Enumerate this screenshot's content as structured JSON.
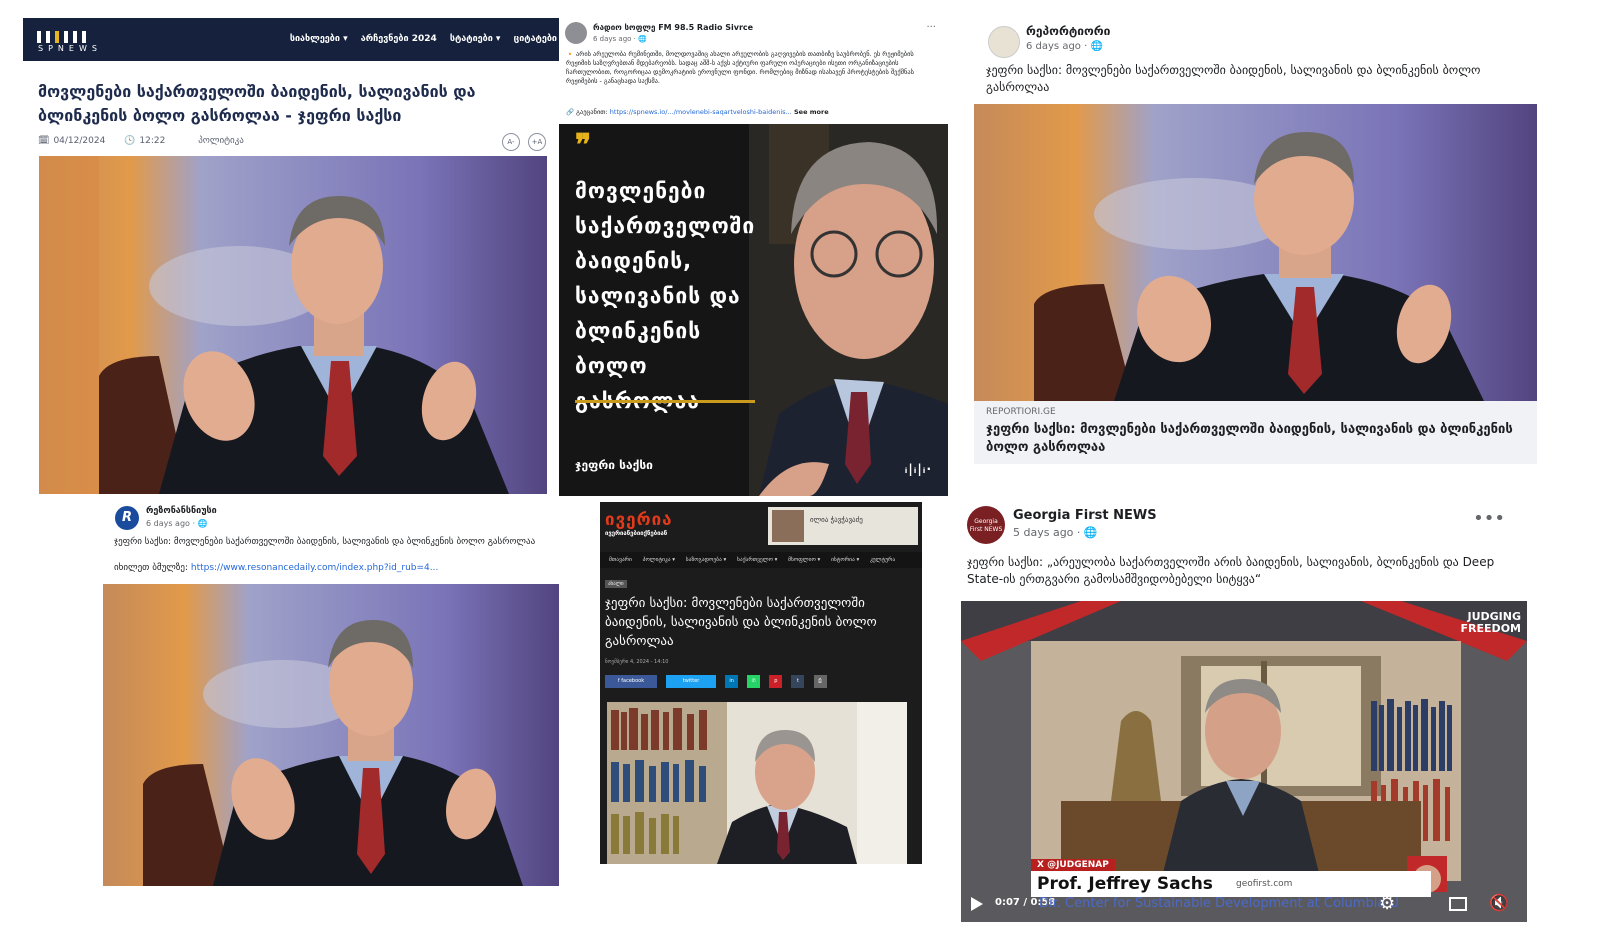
{
  "spnews": {
    "logo": "SPNEWS",
    "menu": [
      "სიახლეები ▾",
      "არჩევნები 2024",
      "სტატიები ▾",
      "ციტატები"
    ],
    "headline": "მოვლენები საქართველოში ბაიდენის, სალივანის და ბლინკენის ბოლო გასროლაა - ჯეფრი საქსი",
    "date": "04/12/2024",
    "time": "12:22",
    "category": "პოლიტიკა",
    "font_minus": "A-",
    "font_plus": "+A"
  },
  "radio_post": {
    "page_name": "რადიო სოფლე FM 98.5 Radio Sivrce",
    "time": "6 days ago · ",
    "body": "🔸 არის არეულობა რუმინეთში, მოლდოვაშიც ახალი არეულობის გაღვივების თათბიზე საუბრობენ. ეს რეჟიმების რეჟიმის საზღვრებთან მდებარეობს. სადაც აშშ-ს აქვს აქტიური ფარული ოპერაციები ისეთი ორგანიზაციების ჩართულობით, როგორიცაა დემოკრატიის ეროვნული ფონდი. რომლებიც მიზნად ისახავენ პროტესტების შექმნას რეჟიმების - განაცხადა საქსმა.",
    "link_label": "🔗 გაეცანით: ",
    "link": "https://spnews.io/.../movlenebi-saqartveloshi-baidenis...",
    "see_more": " See more",
    "image_text": "მოვლენები საქართველოში ბაიდენის, სალივანის და ბლინკენის ბოლო გასროლაა",
    "signature": "ჯეფრი საქსი",
    "watermark": "ᵢ|ᵢ|ᵢ·"
  },
  "reportiori_post": {
    "page_name": "რეპორტიორი",
    "time": "6 days ago · ",
    "caption": "ჯეფრი საქსი: მოვლენები საქართველოში ბაიდენის, სალივანის და ბლინკენის ბოლო გასროლაა",
    "domain": "REPORTIORI.GE",
    "link_title": "ჯეფრი საქსი: მოვლენები საქართველოში ბაიდენის, სალივანის და ბლინკენის ბოლო გასროლაა"
  },
  "resonance_post": {
    "page_name": "რეზონანსნიუსი",
    "avatar_letter": "R",
    "time": "6 days ago · ",
    "body": "ჯეფრი საქსი: მოვლენები საქართველოში ბაიდენის, სალივანის და ბლინკენის ბოლო გასროლაა",
    "link_label": "იხილეთ ბმულზე: ",
    "link": "https://www.resonancedaily.com/index.php?id_rub=4..."
  },
  "iveria": {
    "logo": "ივერია",
    "logo_sub": "ივერიანებიიქნებიან",
    "banner_text": "ილია ჭავჭავაძე",
    "nav": [
      "მთავარი",
      "პოლიტიკა ▾",
      "საზოგადოება ▾",
      "საქართველო ▾",
      "მსოფლიო ▾",
      "ისტორია ▾",
      "კულტურა"
    ],
    "tag": "ახალი",
    "title": "ჯეფრი საქსი: მოვლენები საქართველოში ბაიდენის, სალივანის და ბლინკენის ბოლო გასროლაა",
    "date": "ნოემბერი 4, 2024 - 14:10",
    "share_facebook": "f  facebook",
    "share_twitter": "twitter"
  },
  "gfn_post": {
    "page_name": "Georgia First NEWS",
    "avatar_text": "Georgia First NEWS",
    "time": "5 days ago · ",
    "body": "ჯეფრი საქსი: „არეულობა საქართველოში არის ბაიდენის, სალივანის, ბლინკენის და Deep State-ის ერთგვარი გამოსამშვიდობებელი სიტყვა“",
    "show_title_1": "JUDGING",
    "show_title_2": "FREEDOM",
    "handle": "X @JUDGENAP",
    "lower_third_name": "Prof. Jeffrey Sachs",
    "lower_third_desc": "Dir. Center for Sustainable Development at Columbia U",
    "video_time": "0:07 / 0:58",
    "watermark": "geofirst.com"
  },
  "colors": {
    "spnews_nav": "#16223d",
    "spnews_accent": "#e6b422",
    "radio_gold": "#c99a1c",
    "iveria_red": "#e23a1a",
    "fb_link": "#2468d8",
    "fb_footer": "#f0f2f5",
    "gfn_red": "#b8201f"
  }
}
